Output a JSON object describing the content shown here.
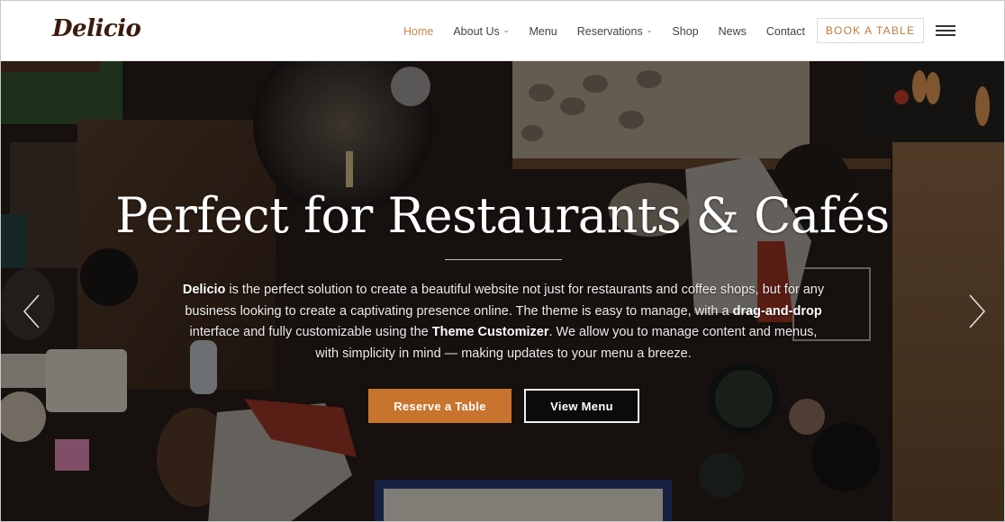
{
  "header": {
    "logo": "Delicio",
    "nav": [
      {
        "label": "Home",
        "active": true,
        "has_dropdown": false
      },
      {
        "label": "About Us",
        "active": false,
        "has_dropdown": true
      },
      {
        "label": "Menu",
        "active": false,
        "has_dropdown": false
      },
      {
        "label": "Reservations",
        "active": false,
        "has_dropdown": true
      },
      {
        "label": "Shop",
        "active": false,
        "has_dropdown": false
      },
      {
        "label": "News",
        "active": false,
        "has_dropdown": false
      },
      {
        "label": "Contact",
        "active": false,
        "has_dropdown": false
      }
    ],
    "dropdown_glyph": "⌄",
    "book_button": "BOOK A TABLE",
    "menu_icon": "hamburger-icon"
  },
  "hero": {
    "title": "Perfect for Restaurants & Cafés",
    "description": {
      "brand": "Delicio",
      "part1": " is the perfect solution to create a beautiful website not just for restaurants and coffee shops, but for any business looking to create a captivating presence online. The theme is easy to manage, with a ",
      "bold1": "drag-and-drop",
      "part2": " interface and fully customizable using the ",
      "bold2": "Theme Customizer",
      "part3": ". We allow you to manage content and menus, with simplicity in mind — making updates to your menu a breeze."
    },
    "primary_button": "Reserve a Table",
    "secondary_button": "View Menu",
    "prev_icon": "chevron-left-icon",
    "next_icon": "chevron-right-icon",
    "background": "overhead photo of restaurant kitchen workers with oysters and food trays"
  },
  "colors": {
    "accent": "#c8742e",
    "nav_active": "#c8884c",
    "logo": "#3b1a0e",
    "nav_text": "#444444"
  }
}
